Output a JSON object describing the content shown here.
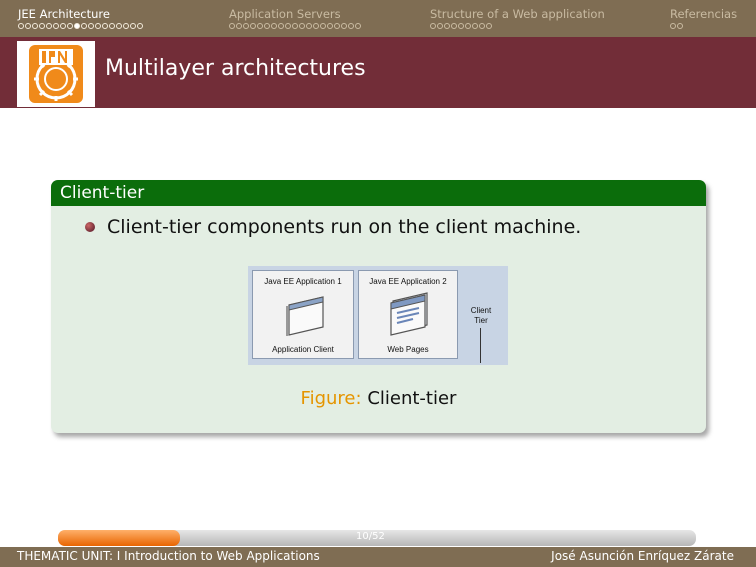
{
  "nav": {
    "sections": [
      {
        "label": "JEE Architecture",
        "dots": 18,
        "current_dot": 8,
        "active": true
      },
      {
        "label": "Application Servers",
        "dots": 19,
        "current_dot": -1,
        "active": false
      },
      {
        "label": "Structure of a Web application",
        "dots": 9,
        "current_dot": -1,
        "active": false
      },
      {
        "label": "Referencias",
        "dots": 2,
        "current_dot": -1,
        "active": false
      }
    ]
  },
  "frame": {
    "title": "Multilayer architectures"
  },
  "block": {
    "title": "Client-tier",
    "bullet": "Client-tier components run on the client machine."
  },
  "figure": {
    "box1_title": "Java EE Application 1",
    "box1_label": "Application Client",
    "box2_title": "Java EE Application 2",
    "box2_label": "Web Pages",
    "tier_line1": "Client",
    "tier_line2": "Tier",
    "caption_prefix": "Figure:",
    "caption_text": "Client-tier"
  },
  "progress": {
    "page": "10/52",
    "fraction": 0.192
  },
  "footer": {
    "left": "THEMATIC UNIT: I Introduction to Web Applications",
    "right": "José Asunción Enríquez Zárate"
  },
  "colors": {
    "nav_bg": "#7f6d53",
    "title_bg": "#722d38",
    "block_head": "#0b6d0b",
    "block_body": "#e3eee3",
    "caption_accent": "#e59500",
    "progress": "#f07a10"
  }
}
